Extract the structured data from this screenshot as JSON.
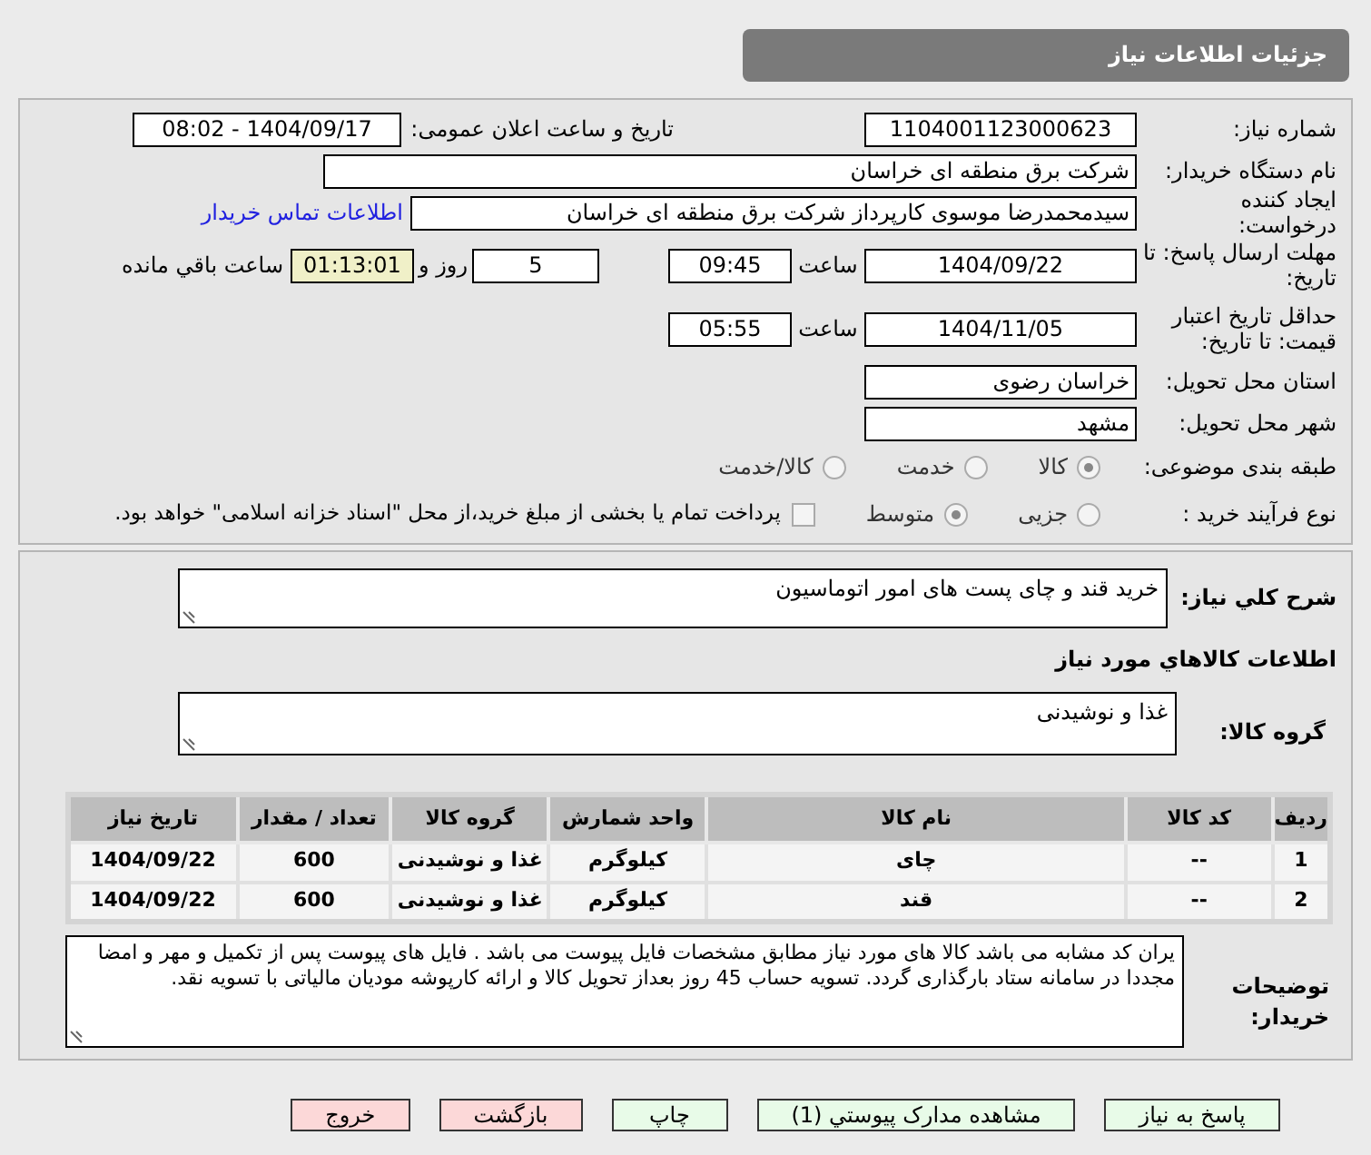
{
  "title": "جزئیات اطلاعات نیاز",
  "need_number": {
    "label": "شماره نیاز:",
    "value": "1104001123000623"
  },
  "announce": {
    "label": "تاریخ و ساعت اعلان عمومی:",
    "value": "1404/09/17 - 08:02"
  },
  "buyer": {
    "label": "نام دستگاه خریدار:",
    "value": "شرکت برق منطقه ای خراسان"
  },
  "creator": {
    "label": "ایجاد کننده درخواست:",
    "value": "سیدمحمدرضا موسوی کارپرداز شرکت برق منطقه ای خراسان",
    "link": "اطلاعات تماس خریدار"
  },
  "deadline": {
    "label": "مهلت ارسال پاسخ: تا تاریخ:",
    "date": "1404/09/22",
    "time_label": "ساعت",
    "time": "09:45",
    "days": "5",
    "days_label": "روز و",
    "remaining": "01:13:01",
    "remaining_label": "ساعت باقي مانده"
  },
  "validity": {
    "label": "حداقل تاریخ اعتبار قیمت: تا تاریخ:",
    "date": "1404/11/05",
    "time_label": "ساعت",
    "time": "05:55"
  },
  "province": {
    "label": "استان محل تحویل:",
    "value": "خراسان رضوی"
  },
  "city": {
    "label": "شهر محل تحویل:",
    "value": "مشهد"
  },
  "category": {
    "label": "طبقه بندی موضوعی:",
    "options": [
      {
        "label": "کالا",
        "selected": true
      },
      {
        "label": "خدمت",
        "selected": false
      },
      {
        "label": "کالا/خدمت",
        "selected": false
      }
    ]
  },
  "process": {
    "label": "نوع فرآیند خرید :",
    "options": [
      {
        "label": "جزیی",
        "selected": false
      },
      {
        "label": "متوسط",
        "selected": true
      }
    ],
    "payment": {
      "label": "پرداخت تمام یا بخشی از مبلغ خرید،از محل \"اسناد خزانه اسلامی\" خواهد بود.",
      "checked": false
    }
  },
  "summary": {
    "label": "شرح کلي نیاز:",
    "value": "خرید قند و چای  پست های امور اتوماسیون"
  },
  "goods_heading": "اطلاعات کالاهاي مورد نیاز",
  "goods_group": {
    "label": "گروه کالا:",
    "value": "غذا و نوشیدنی"
  },
  "table": {
    "columns": [
      "ردیف",
      "کد کالا",
      "نام کالا",
      "واحد شمارش",
      "گروه کالا",
      "تعداد / مقدار",
      "تاریخ نیاز"
    ],
    "rows": [
      [
        "1",
        "--",
        "چای",
        "کیلوگرم",
        "غذا و نوشیدنی",
        "600",
        "1404/09/22"
      ],
      [
        "2",
        "--",
        "قند",
        "کیلوگرم",
        "غذا و نوشیدنی",
        "600",
        "1404/09/22"
      ]
    ]
  },
  "description": {
    "label": "توضیحات خریدار:",
    "value": "یران کد مشابه می باشد کالا های مورد نیاز مطابق مشخصات فایل پیوست می باشد . فایل های پیوست پس از تکمیل و مهر و امضا مجددا در سامانه ستاد بارگذاری گردد. تسویه حساب 45 روز بعداز تحویل کالا و ارائه کارپوشه مودیان مالیاتی با تسویه نقد."
  },
  "buttons": [
    {
      "label": "پاسخ به نیاز",
      "kind": "action"
    },
    {
      "label": "مشاهده مدارک پیوستي (1)",
      "kind": "action"
    },
    {
      "label": "چاپ",
      "kind": "action"
    },
    {
      "label": "بازگشت",
      "kind": "exit"
    },
    {
      "label": "خروج",
      "kind": "exit"
    }
  ]
}
